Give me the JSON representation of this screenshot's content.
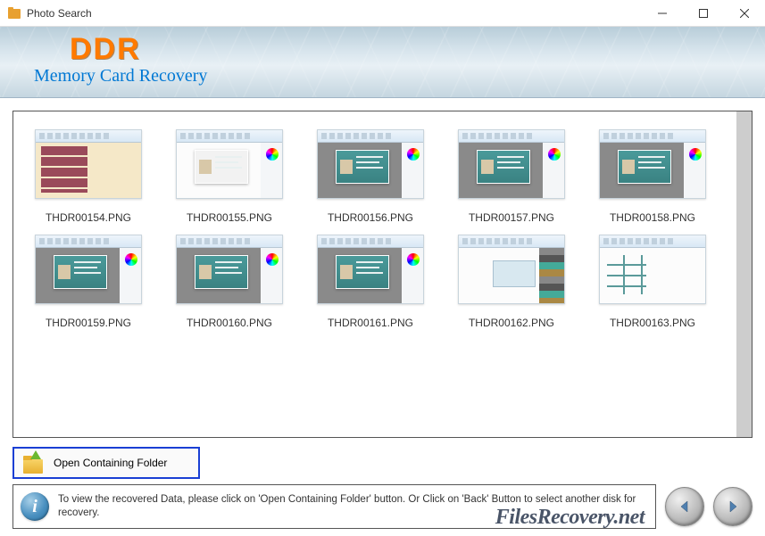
{
  "window": {
    "title": "Photo Search"
  },
  "header": {
    "brand": "DDR",
    "product": "Memory Card Recovery"
  },
  "thumbnails": [
    {
      "label": "THDR00154.PNG",
      "variant": "a"
    },
    {
      "label": "THDR00155.PNG",
      "variant": "b"
    },
    {
      "label": "THDR00156.PNG",
      "variant": ""
    },
    {
      "label": "THDR00157.PNG",
      "variant": ""
    },
    {
      "label": "THDR00158.PNG",
      "variant": ""
    },
    {
      "label": "THDR00159.PNG",
      "variant": ""
    },
    {
      "label": "THDR00160.PNG",
      "variant": ""
    },
    {
      "label": "THDR00161.PNG",
      "variant": ""
    },
    {
      "label": "THDR00162.PNG",
      "variant": "d"
    },
    {
      "label": "THDR00163.PNG",
      "variant": "e"
    }
  ],
  "actions": {
    "open_folder": "Open Containing Folder"
  },
  "footer": {
    "info_text": "To view the recovered Data, please click on 'Open Containing Folder' button. Or Click on 'Back' Button to select another disk for recovery.",
    "watermark": "FilesRecovery.net"
  }
}
